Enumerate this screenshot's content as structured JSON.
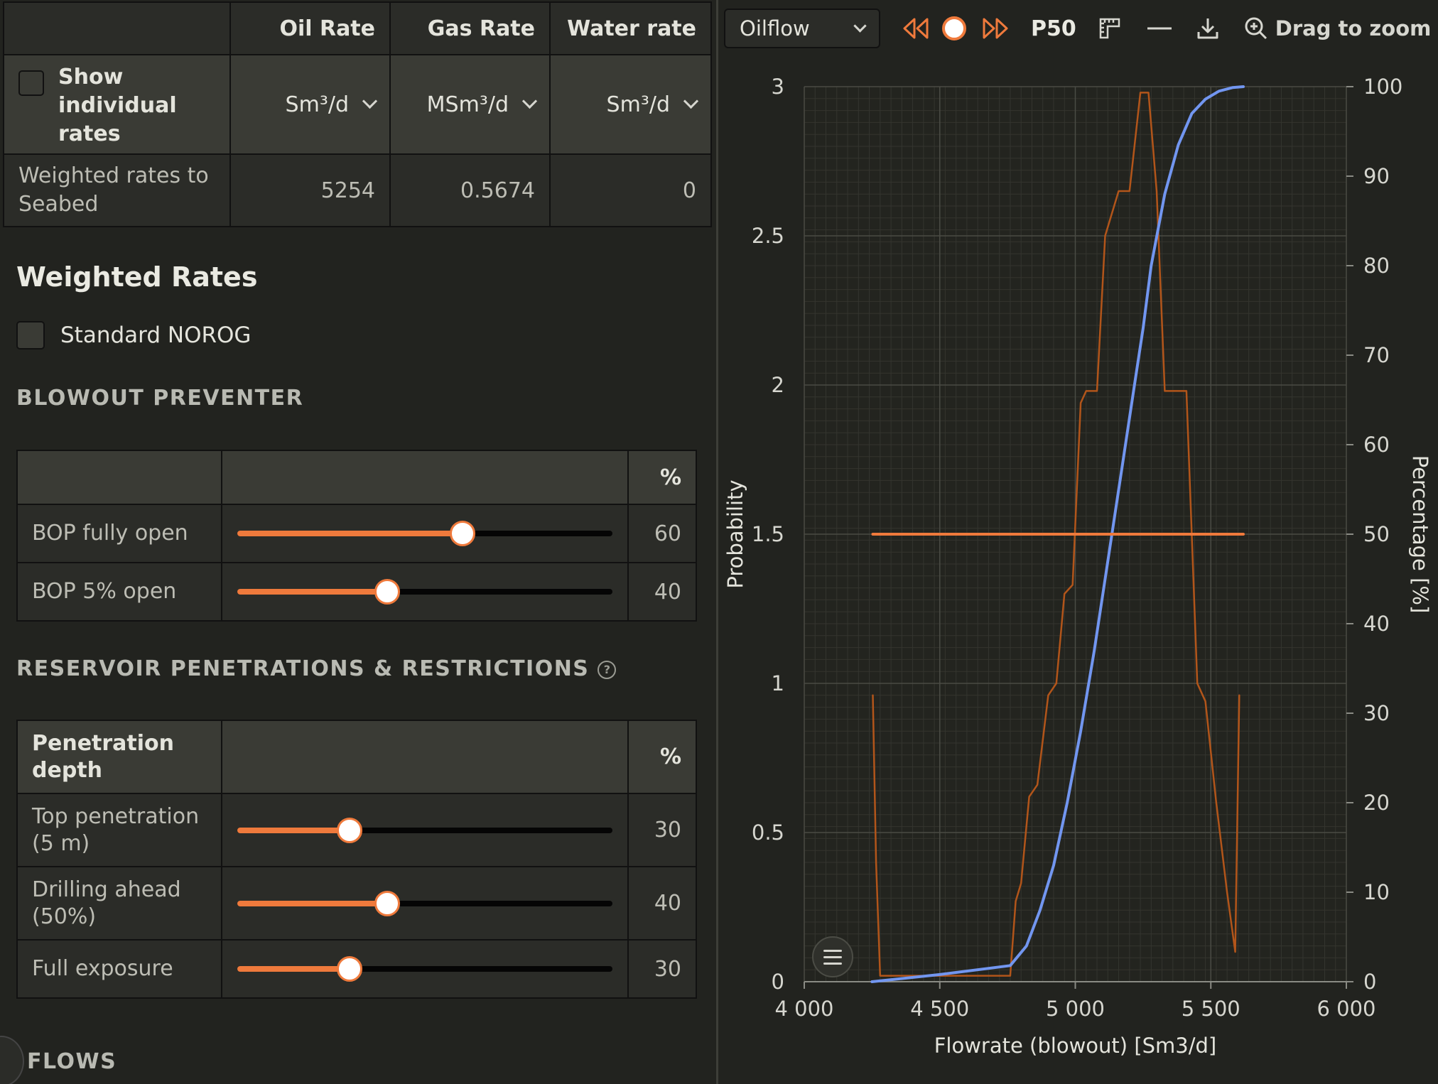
{
  "rates_table": {
    "headers": [
      "",
      "Oil Rate",
      "Gas Rate",
      "Water rate"
    ],
    "show_individual_label": "Show individual rates",
    "units": [
      "Sm³/d",
      "MSm³/d",
      "Sm³/d"
    ],
    "row_label": "Weighted rates to Seabed",
    "values": [
      "5254",
      "0.5674",
      "0"
    ]
  },
  "weighted_rates": {
    "title": "Weighted Rates",
    "norog_label": "Standard NOROG"
  },
  "bop": {
    "title": "BLOWOUT PREVENTER",
    "pct_header": "%",
    "rows": [
      {
        "label": "BOP fully open",
        "value": "60",
        "fraction": 0.6
      },
      {
        "label": "BOP 5% open",
        "value": "40",
        "fraction": 0.4
      }
    ]
  },
  "reservoir": {
    "title": "RESERVOIR PENETRATIONS & RESTRICTIONS",
    "help_glyph": "?",
    "col_header": "Penetration depth",
    "pct_header": "%",
    "rows": [
      {
        "label": "Top penetration (5 m)",
        "value": "30",
        "fraction": 0.3
      },
      {
        "label": "Drilling ahead (50%)",
        "value": "40",
        "fraction": 0.4
      },
      {
        "label": "Full exposure",
        "value": "30",
        "fraction": 0.3
      }
    ]
  },
  "flows_label": "FLOWS",
  "toolbar": {
    "dropdown_value": "Oilflow",
    "p50_label": "P50",
    "zoom_label": "Drag to zoom",
    "accent": "#ef7a3c"
  },
  "icons": {
    "prev": "rewind-icon",
    "play": "record-icon",
    "next": "fast-forward-icon",
    "ruler": "ruler-icon",
    "line": "line-icon",
    "download": "download-icon",
    "zoom": "zoom-in-icon",
    "legend": "list-icon"
  },
  "chart_data": {
    "type": "line",
    "xlabel": "Flowrate (blowout) [Sm3/d]",
    "ylabel": "Probability",
    "y2label": "Percentage [%]",
    "xlim": [
      4000,
      6000
    ],
    "ylim": [
      0,
      3
    ],
    "y2lim": [
      0,
      100
    ],
    "x_ticks": [
      4000,
      4500,
      5000,
      5500,
      6000
    ],
    "x_tick_labels": [
      "4 000",
      "4 500",
      "5 000",
      "5 500",
      "6 000"
    ],
    "y_ticks": [
      0,
      0.5,
      1,
      1.5,
      2,
      2.5,
      3
    ],
    "y_tick_labels": [
      "0",
      "0.5",
      "1",
      "1.5",
      "2",
      "2.5",
      "3"
    ],
    "y2_ticks": [
      0,
      10,
      20,
      30,
      40,
      50,
      60,
      70,
      80,
      90,
      100
    ],
    "y2_tick_labels": [
      "0",
      "10",
      "20",
      "30",
      "40",
      "50",
      "60",
      "70",
      "80",
      "90",
      "100"
    ],
    "grid": true,
    "series": [
      {
        "axis": "left",
        "color": "#b2551a",
        "x": [
          4253,
          4265,
          4280,
          4500,
          4760,
          4780,
          4800,
          4830,
          4860,
          4900,
          4930,
          4960,
          4990,
          5020,
          5040,
          5080,
          5110,
          5160,
          5200,
          5240,
          5270,
          5300,
          5330,
          5360,
          5410,
          5450,
          5480,
          5520,
          5560,
          5590,
          5605
        ],
        "y": [
          0.96,
          0.4,
          0.02,
          0.02,
          0.02,
          0.27,
          0.33,
          0.62,
          0.66,
          0.96,
          1.0,
          1.3,
          1.33,
          1.94,
          1.98,
          1.98,
          2.5,
          2.65,
          2.65,
          2.98,
          2.98,
          2.65,
          1.98,
          1.98,
          1.98,
          1.0,
          0.94,
          0.6,
          0.3,
          0.1,
          0.96
        ]
      },
      {
        "axis": "right",
        "color": "#7296f0",
        "x": [
          4250,
          4500,
          4760,
          4820,
          4870,
          4920,
          4970,
          5020,
          5070,
          5120,
          5170,
          5220,
          5250,
          5280,
          5330,
          5380,
          5430,
          5480,
          5530,
          5580,
          5620
        ],
        "y": [
          0,
          0.8,
          1.8,
          4,
          8,
          13,
          20,
          28,
          37,
          47,
          57,
          67,
          73,
          80,
          88,
          93.5,
          97,
          98.6,
          99.5,
          99.9,
          100
        ]
      },
      {
        "axis": "right",
        "color": "#ef7a3c",
        "x": [
          4253,
          5620
        ],
        "y": [
          50,
          50
        ]
      }
    ]
  }
}
